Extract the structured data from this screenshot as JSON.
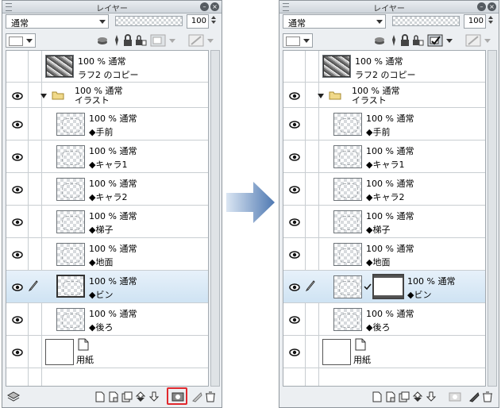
{
  "panels": [
    {
      "id": "before",
      "title": "レイヤー",
      "blend_mode": "通常",
      "opacity": "100",
      "layers": [
        {
          "kind": "raster",
          "opacity_mode": "100 % 通常",
          "name": "ラフ2 のコピー",
          "thumb": "dark"
        },
        {
          "kind": "folder",
          "opacity_mode": "100 % 通常",
          "name": "イラスト"
        },
        {
          "kind": "raster",
          "opacity_mode": "100 % 通常",
          "name": "◆手前",
          "thumb": "checker"
        },
        {
          "kind": "raster",
          "opacity_mode": "100 % 通常",
          "name": "◆キャラ1",
          "thumb": "checker"
        },
        {
          "kind": "raster",
          "opacity_mode": "100 % 通常",
          "name": "◆キャラ2",
          "thumb": "checker"
        },
        {
          "kind": "raster",
          "opacity_mode": "100 % 通常",
          "name": "◆梯子",
          "thumb": "checker"
        },
        {
          "kind": "raster",
          "opacity_mode": "100 % 通常",
          "name": "◆地面",
          "thumb": "checker"
        },
        {
          "kind": "raster",
          "opacity_mode": "100 % 通常",
          "name": "◆ビン",
          "thumb": "checker",
          "selected": true
        },
        {
          "kind": "raster",
          "opacity_mode": "100 % 通常",
          "name": "◆後ろ",
          "thumb": "checker"
        },
        {
          "kind": "paper",
          "name": "用紙"
        }
      ],
      "highlighted_button": "create-mask-button"
    },
    {
      "id": "after",
      "title": "レイヤー",
      "blend_mode": "通常",
      "opacity": "100",
      "layers": [
        {
          "kind": "raster",
          "opacity_mode": "100 % 通常",
          "name": "ラフ2 のコピー",
          "thumb": "dark"
        },
        {
          "kind": "folder",
          "opacity_mode": "100 % 通常",
          "name": "イラスト"
        },
        {
          "kind": "raster",
          "opacity_mode": "100 % 通常",
          "name": "◆手前",
          "thumb": "checker"
        },
        {
          "kind": "raster",
          "opacity_mode": "100 % 通常",
          "name": "◆キャラ1",
          "thumb": "checker"
        },
        {
          "kind": "raster",
          "opacity_mode": "100 % 通常",
          "name": "◆キャラ2",
          "thumb": "checker"
        },
        {
          "kind": "raster",
          "opacity_mode": "100 % 通常",
          "name": "◆梯子",
          "thumb": "checker"
        },
        {
          "kind": "raster",
          "opacity_mode": "100 % 通常",
          "name": "◆地面",
          "thumb": "checker"
        },
        {
          "kind": "raster",
          "opacity_mode": "100 % 通常",
          "name": "◆ビン",
          "thumb": "checker",
          "selected": true,
          "mask": true
        },
        {
          "kind": "raster",
          "opacity_mode": "100 % 通常",
          "name": "◆後ろ",
          "thumb": "checker"
        },
        {
          "kind": "paper",
          "name": "用紙"
        }
      ]
    }
  ],
  "colors": {
    "highlight": "#e0282d",
    "selection": "#cfe3f3",
    "arrow": "#4f79b2"
  },
  "icons": [
    "eye-icon",
    "pencil-icon",
    "folder-icon",
    "lock-icon",
    "new-layer-icon",
    "mask-icon",
    "trash-icon",
    "layer-stack-icon"
  ]
}
